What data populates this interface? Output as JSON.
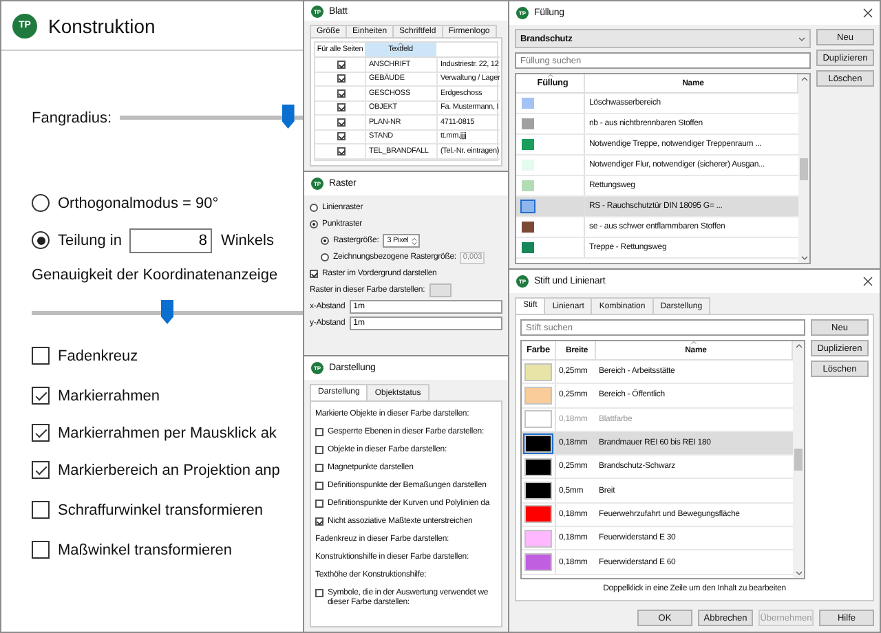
{
  "konstruktion": {
    "app_icon": "TP",
    "title": "Konstruktion",
    "snap_label": "Fangradius:",
    "snap_slider": {
      "level": 0.95
    },
    "modes": [
      {
        "label": "Orthogonalmodus = 90°",
        "selected": false
      },
      {
        "label": "Teilung in",
        "selected": true,
        "value": "8",
        "suffix": "Winkels"
      }
    ],
    "accuracy_label": "Genauigkeit der Koordinatenanzeige",
    "accuracy_slider": {
      "level": 0.5
    },
    "options": [
      {
        "label": "Fadenkreuz",
        "checked": false
      },
      {
        "label": "Markierrahmen",
        "checked": true
      },
      {
        "label": "Markierrahmen per Mausklick ak",
        "checked": true
      },
      {
        "label": "Markierbereich an Projektion anp",
        "checked": true
      },
      {
        "label": "Schraffurwinkel transformieren",
        "checked": false
      },
      {
        "label": "Maßwinkel transformieren",
        "checked": false
      }
    ]
  },
  "blatt": {
    "app_icon": "TP",
    "title": "Blatt",
    "tabs": [
      {
        "label": "Größe",
        "selected": false
      },
      {
        "label": "Einheiten",
        "selected": false
      },
      {
        "label": "Schriftfeld",
        "selected": false
      },
      {
        "label": "Firmenlogo",
        "selected": false
      }
    ],
    "columns": [
      {
        "label": "Für alle Seiten",
        "sorted": false
      },
      {
        "label": "Textfeld",
        "sorted": true
      }
    ],
    "rows": [
      {
        "checked": true,
        "field": "ANSCHRIFT",
        "value": "Industriestr. 22, 12"
      },
      {
        "checked": true,
        "field": "GEBÄUDE",
        "value": "Verwaltung / Lager"
      },
      {
        "checked": true,
        "field": "GESCHOSS",
        "value": "Erdgeschoss"
      },
      {
        "checked": true,
        "field": "OBJEKT",
        "value": "Fa. Mustermann, I"
      },
      {
        "checked": true,
        "field": "PLAN-NR",
        "value": "4711-0815"
      },
      {
        "checked": true,
        "field": "STAND",
        "value": "tt.mm.jjjj"
      },
      {
        "checked": true,
        "field": "TEL_BRANDFALL",
        "value": "(Tel.-Nr. eintragen)"
      }
    ]
  },
  "raster": {
    "app_icon": "TP",
    "title": "Raster",
    "options": [
      {
        "label": "Linienraster",
        "selected": false
      },
      {
        "label": "Punktraster",
        "selected": true,
        "children": [
          {
            "label": "Rastergröße:",
            "selected": true,
            "spin_value": "3 Pixel"
          },
          {
            "label": "Zeichnungsbezogene Rastergröße:",
            "selected": false,
            "value": "0,003"
          }
        ]
      }
    ],
    "foreground": {
      "label": "Raster im Vordergrund darstellen",
      "checked": true
    },
    "color_label": "Raster in dieser Farbe darstellen:",
    "spacing": [
      {
        "label": "x-Abstand",
        "value": "1m"
      },
      {
        "label": "y-Abstand",
        "value": "1m"
      }
    ]
  },
  "darstellung": {
    "app_icon": "TP",
    "title": "Darstellung",
    "tabs": [
      {
        "label": "Darstellung",
        "selected": true
      },
      {
        "label": "Objektstatus",
        "selected": false
      }
    ],
    "items": [
      {
        "kind": "text",
        "label": "Markierte Objekte in dieser Farbe darstellen:"
      },
      {
        "kind": "checkbox",
        "label": "Gesperrte Ebenen in dieser Farbe darstellen:",
        "checked": false
      },
      {
        "kind": "checkbox",
        "label": "Objekte in dieser Farbe darstellen:",
        "checked": false
      },
      {
        "kind": "checkbox",
        "label": "Magnetpunkte darstellen",
        "checked": false
      },
      {
        "kind": "checkbox",
        "label": "Definitionspunkte der Bemaßungen darstellen",
        "checked": false
      },
      {
        "kind": "checkbox",
        "label": "Definitionspunkte der Kurven und Polylinien da",
        "checked": false
      },
      {
        "kind": "checkbox",
        "label": "Nicht assoziative Maßtexte unterstreichen",
        "checked": true
      },
      {
        "kind": "text",
        "label": "Fadenkreuz in dieser Farbe darstellen:"
      },
      {
        "kind": "text",
        "label": "Konstruktionshilfe in dieser Farbe darstellen:"
      },
      {
        "kind": "text",
        "label": "Texthöhe der Konstruktionshilfe:"
      },
      {
        "kind": "checkbox",
        "label_lines": [
          "Symbole, die in der Auswertung verwendet we",
          "dieser Farbe darstellen:"
        ],
        "checked": false
      }
    ]
  },
  "fuellung": {
    "app_icon": "TP",
    "title": "Füllung",
    "category": "Brandschutz",
    "search_placeholder": "Füllung suchen",
    "buttons": [
      "Neu",
      "Duplizieren",
      "Löschen"
    ],
    "columns": [
      {
        "label": "Füllung",
        "sorted": true
      },
      {
        "label": "Name",
        "sorted": false
      }
    ],
    "rows": [
      {
        "color": "#a4c2f4",
        "name": "Löschwasserbereich",
        "selected": false
      },
      {
        "color": "#a0a0a0",
        "name": "nb - aus nichtbrennbaren Stoffen",
        "selected": false
      },
      {
        "color": "#1a9e5c",
        "name": "Notwendige Treppe, notwendiger Treppenraum ...",
        "selected": false
      },
      {
        "color": "#e4fbef",
        "name": "Notwendiger Flur, notwendiger (sicherer) Ausgan...",
        "selected": false
      },
      {
        "color": "#b4dcb4",
        "name": "Rettungsweg",
        "selected": false
      },
      {
        "color": "#8fb5ee",
        "name": "RS - Rauchschutztür DIN 18095 G= ...",
        "selected": true
      },
      {
        "color": "#7a4a36",
        "name": "se - aus schwer entflammbaren Stoffen",
        "selected": false
      },
      {
        "color": "#17875a",
        "name": "Treppe - Rettungsweg",
        "selected": false
      }
    ]
  },
  "stift": {
    "app_icon": "TP",
    "title": "Stift und Linienart",
    "tabs": [
      {
        "label": "Stift",
        "selected": true
      },
      {
        "label": "Linienart",
        "selected": false
      },
      {
        "label": "Kombination",
        "selected": false
      },
      {
        "label": "Darstellung",
        "selected": false
      }
    ],
    "search_placeholder": "Stift suchen",
    "buttons": [
      "Neu",
      "Duplizieren",
      "Löschen"
    ],
    "columns": [
      {
        "label": "Farbe",
        "sorted": false
      },
      {
        "label": "Breite",
        "sorted": false
      },
      {
        "label": "Name",
        "sorted": true
      }
    ],
    "rows": [
      {
        "color": "#e8e4a8",
        "width": "0,25mm",
        "name": "Bereich - Arbeitsstätte",
        "muted": false,
        "selected": false
      },
      {
        "color": "#f9cc99",
        "width": "0,25mm",
        "name": "Bereich - Öffentlich",
        "muted": false,
        "selected": false
      },
      {
        "color": "#ffffff",
        "width": "0,18mm",
        "name": "Blattfarbe",
        "muted": true,
        "selected": false
      },
      {
        "color": "#000000",
        "width": "0,18mm",
        "name": "Brandmauer REI 60 bis REI 180",
        "muted": false,
        "selected": true
      },
      {
        "color": "#000000",
        "width": "0,25mm",
        "name": "Brandschutz-Schwarz",
        "muted": false,
        "selected": false
      },
      {
        "color": "#000000",
        "width": "0,5mm",
        "name": "Breit",
        "muted": false,
        "selected": false
      },
      {
        "color": "#ff0000",
        "width": "0,18mm",
        "name": "Feuerwehrzufahrt und Bewegungsfläche",
        "muted": false,
        "selected": false
      },
      {
        "color": "#ffb8ff",
        "width": "0,18mm",
        "name": "Feuerwiderstand E 30",
        "muted": false,
        "selected": false
      },
      {
        "color": "#c060e0",
        "width": "0,18mm",
        "name": "Feuerwiderstand E 60",
        "muted": false,
        "selected": false
      }
    ],
    "hint": "Doppelklick in eine Zeile um den Inhalt zu bearbeiten",
    "footer_buttons": [
      {
        "label": "OK",
        "disabled": false
      },
      {
        "label": "Abbrechen",
        "disabled": false
      },
      {
        "label": "Übernehmen",
        "disabled": true
      },
      {
        "label": "Hilfe",
        "disabled": false
      }
    ]
  }
}
